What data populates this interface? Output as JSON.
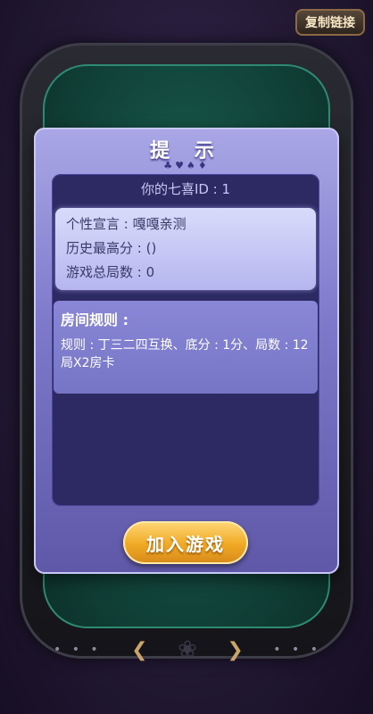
{
  "toolbar": {
    "copy_link_label": "复制链接"
  },
  "dialog": {
    "title": "提 示",
    "suits": "♣♥♠♦",
    "user_id": "你的七喜ID : 1",
    "profile": {
      "motto": "个性宣言 : 嘎嘎亲测",
      "high_score": "历史最高分 : ()",
      "total_games": "游戏总局数 : 0"
    },
    "rules": {
      "title": "房间规则 :",
      "text": "规则 : 丁三二四互换、底分 : 1分、局数 : 12局X2房卡"
    },
    "join_label": "加入游戏"
  },
  "colors": {
    "dialog_bg": "#7d78c9",
    "inner_panel": "#2d2a63",
    "join_button": "#f0a924",
    "felt": "#1f6a58"
  }
}
